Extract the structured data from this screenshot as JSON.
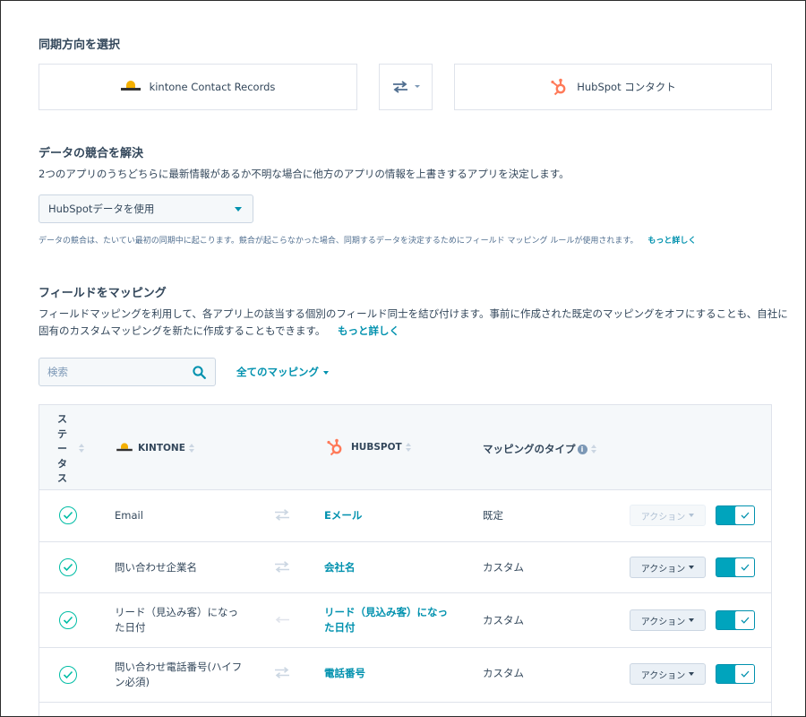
{
  "sync_direction": {
    "heading": "同期方向を選択",
    "left_app": "kintone Contact Records",
    "right_app": "HubSpot コンタクト"
  },
  "conflict": {
    "heading": "データの競合を解決",
    "description": "2つのアプリのうちどちらに最新情報があるか不明な場合に他方のアプリの情報を上書きするアプリを決定します。",
    "selected": "HubSpotデータを使用",
    "note": "データの競合は、たいてい最初の同期中に起こります。競合が起こらなかった場合、同期するデータを決定するためにフィールド マッピング ルールが使用されます。",
    "learn_more": "もっと詳しく"
  },
  "mapping": {
    "heading": "フィールドをマッピング",
    "description_line1": "フィールドマッピングを利用して、各アプリ上の該当する個別のフィールド同士を結び付けます。事前に作成された既定のマッピングをオフにすることも、自社に",
    "description_line2": "固有のカスタムマッピングを新たに作成することもできます。",
    "learn_more": "もっと詳しく",
    "search_placeholder": "検索",
    "filter_label": "全てのマッピング"
  },
  "table": {
    "headers": {
      "status": [
        "ス",
        "テ",
        "ー",
        "タ",
        "ス"
      ],
      "kintone": "KINTONE",
      "hubspot": "HUBSPOT",
      "mapping_type": "マッピングのタイプ"
    },
    "rows": [
      {
        "source": [
          "Email"
        ],
        "target": [
          "Eメール"
        ],
        "type": "既定",
        "action": "アクション",
        "action_enabled": false,
        "sync": "two-way",
        "enabled": true
      },
      {
        "source": [
          "問い合わせ企業名"
        ],
        "target": [
          "会社名"
        ],
        "type": "カスタム",
        "action": "アクション",
        "action_enabled": true,
        "sync": "two-way",
        "enabled": true
      },
      {
        "source": [
          "リード（見込み客）になっ",
          "た日付"
        ],
        "target": [
          "リード（見込み客）になっ",
          "た日付"
        ],
        "type": "カスタム",
        "action": "アクション",
        "action_enabled": true,
        "sync": "one-way-left",
        "enabled": true
      },
      {
        "source": [
          "問い合わせ電話番号(ハイフ",
          "ン必須)"
        ],
        "target": [
          "電話番号"
        ],
        "type": "カスタム",
        "action": "アクション",
        "action_enabled": true,
        "sync": "two-way",
        "enabled": true
      }
    ]
  },
  "colors": {
    "accent": "#0091ae",
    "toggle_on": "#00a4bd",
    "success": "#00bda5",
    "hubspot_orange": "#ff7a59",
    "kintone_yellow": "#f5b000"
  },
  "icons": {
    "sync_direction": "two-way-arrows-icon",
    "search": "search-icon",
    "status": "check-circle-icon",
    "info": "info-icon"
  }
}
